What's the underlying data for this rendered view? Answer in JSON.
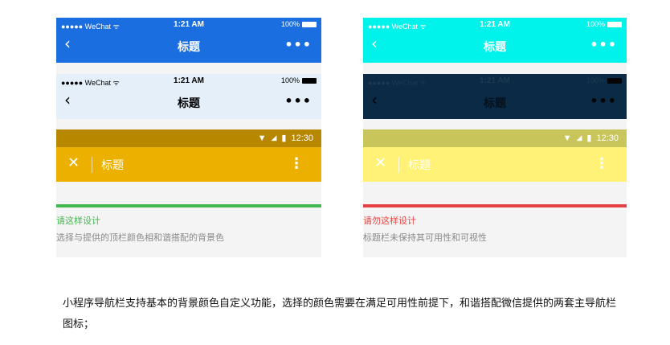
{
  "colors": {
    "good": "#43b84e",
    "bad": "#e64340"
  },
  "good": {
    "bar1": {
      "carrier": "●●●●● WeChat ᯤ",
      "time": "1:21 AM",
      "battery": "100%",
      "back": "‹",
      "title": "标题",
      "more": "•••"
    },
    "bar2": {
      "carrier": "●●●●● WeChat ᯤ",
      "time": "1:21 AM",
      "battery": "100%",
      "back": "‹",
      "title": "标题",
      "more": "•••"
    },
    "android": {
      "time": "12:30",
      "close": "✕",
      "title": "标题",
      "more": "⋮"
    },
    "label": "请这样设计",
    "caption": "选择与提供的顶栏颜色相和谐搭配的背景色"
  },
  "bad": {
    "bar1": {
      "carrier": "●●●●● WeChat ᯤ",
      "time": "1:21 AM",
      "battery": "100%",
      "back": "‹",
      "title": "标题",
      "more": "•••"
    },
    "bar2": {
      "carrier": "●●●●● WeChat ᯤ",
      "time": "1:21 AM",
      "battery": "100%",
      "back": "‹",
      "title": "标题",
      "more": "•••"
    },
    "android": {
      "time": "12:30",
      "close": "✕",
      "title": "标题",
      "more": "⋮"
    },
    "label": "请勿这样设计",
    "caption": "标题栏未保持其可用性和可视性"
  },
  "description": "小程序导航栏支持基本的背景颜色自定义功能，选择的颜色需要在满足可用性前提下，和谐搭配微信提供的两套主导航栏图标；"
}
